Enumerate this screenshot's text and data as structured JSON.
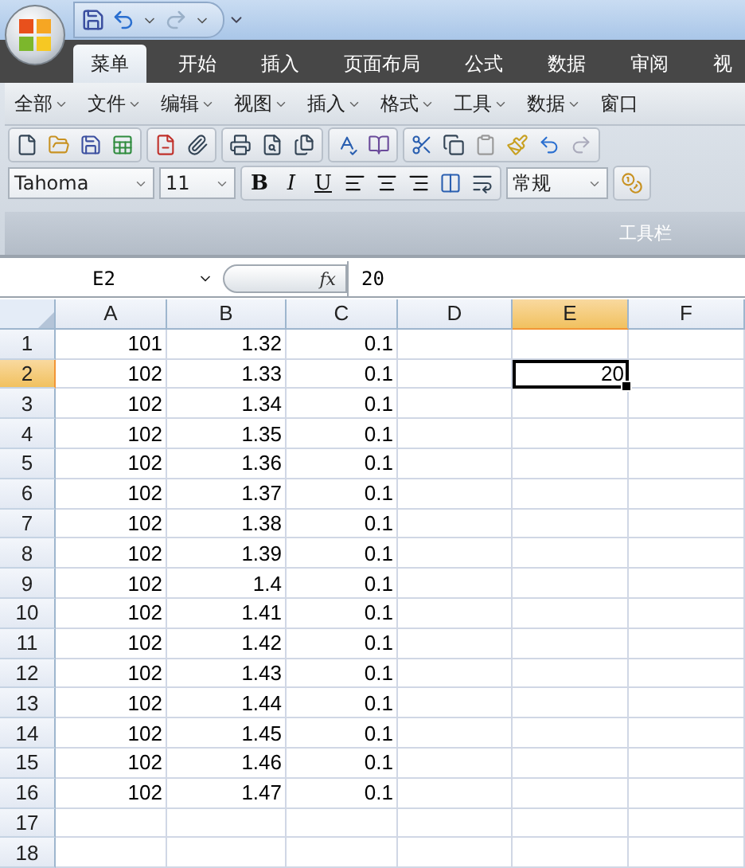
{
  "ribbon_tabs": [
    {
      "label": "菜单",
      "selected": true
    },
    {
      "label": "开始",
      "selected": false
    },
    {
      "label": "插入",
      "selected": false
    },
    {
      "label": "页面布局",
      "selected": false
    },
    {
      "label": "公式",
      "selected": false
    },
    {
      "label": "数据",
      "selected": false
    },
    {
      "label": "审阅",
      "selected": false
    },
    {
      "label": "视",
      "selected": false
    }
  ],
  "menu_bar": [
    {
      "label": "全部",
      "has_dropdown": true
    },
    {
      "label": "文件",
      "has_dropdown": true
    },
    {
      "label": "编辑",
      "has_dropdown": true
    },
    {
      "label": "视图",
      "has_dropdown": true
    },
    {
      "label": "插入",
      "has_dropdown": true
    },
    {
      "label": "格式",
      "has_dropdown": true
    },
    {
      "label": "工具",
      "has_dropdown": true
    },
    {
      "label": "数据",
      "has_dropdown": true
    },
    {
      "label": "窗口",
      "has_dropdown": false
    }
  ],
  "format_toolbar": {
    "font": "Tahoma",
    "size": "11",
    "bold": "B",
    "italic": "I",
    "underline": "U",
    "number_format": "常规"
  },
  "group_label": "工具栏",
  "formula_bar": {
    "name_box": "E2",
    "fx": "fx",
    "formula": "20"
  },
  "columns": [
    {
      "label": "A",
      "selected": false
    },
    {
      "label": "B",
      "selected": false
    },
    {
      "label": "C",
      "selected": false
    },
    {
      "label": "D",
      "selected": false
    },
    {
      "label": "E",
      "selected": true
    },
    {
      "label": "F",
      "selected": false
    }
  ],
  "rows": [
    {
      "label": "1",
      "selected": false,
      "a": "101",
      "b": "1.32",
      "c": "0.1"
    },
    {
      "label": "2",
      "selected": true,
      "a": "102",
      "b": "1.33",
      "c": "0.1",
      "e": "20"
    },
    {
      "label": "3",
      "selected": false,
      "a": "102",
      "b": "1.34",
      "c": "0.1"
    },
    {
      "label": "4",
      "selected": false,
      "a": "102",
      "b": "1.35",
      "c": "0.1"
    },
    {
      "label": "5",
      "selected": false,
      "a": "102",
      "b": "1.36",
      "c": "0.1"
    },
    {
      "label": "6",
      "selected": false,
      "a": "102",
      "b": "1.37",
      "c": "0.1"
    },
    {
      "label": "7",
      "selected": false,
      "a": "102",
      "b": "1.38",
      "c": "0.1"
    },
    {
      "label": "8",
      "selected": false,
      "a": "102",
      "b": "1.39",
      "c": "0.1"
    },
    {
      "label": "9",
      "selected": false,
      "a": "102",
      "b": "1.4",
      "c": "0.1"
    },
    {
      "label": "10",
      "selected": false,
      "a": "102",
      "b": "1.41",
      "c": "0.1"
    },
    {
      "label": "11",
      "selected": false,
      "a": "102",
      "b": "1.42",
      "c": "0.1"
    },
    {
      "label": "12",
      "selected": false,
      "a": "102",
      "b": "1.43",
      "c": "0.1"
    },
    {
      "label": "13",
      "selected": false,
      "a": "102",
      "b": "1.44",
      "c": "0.1"
    },
    {
      "label": "14",
      "selected": false,
      "a": "102",
      "b": "1.45",
      "c": "0.1"
    },
    {
      "label": "15",
      "selected": false,
      "a": "102",
      "b": "1.46",
      "c": "0.1"
    },
    {
      "label": "16",
      "selected": false,
      "a": "102",
      "b": "1.47",
      "c": "0.1"
    },
    {
      "label": "17",
      "selected": false
    },
    {
      "label": "18",
      "selected": false
    }
  ]
}
